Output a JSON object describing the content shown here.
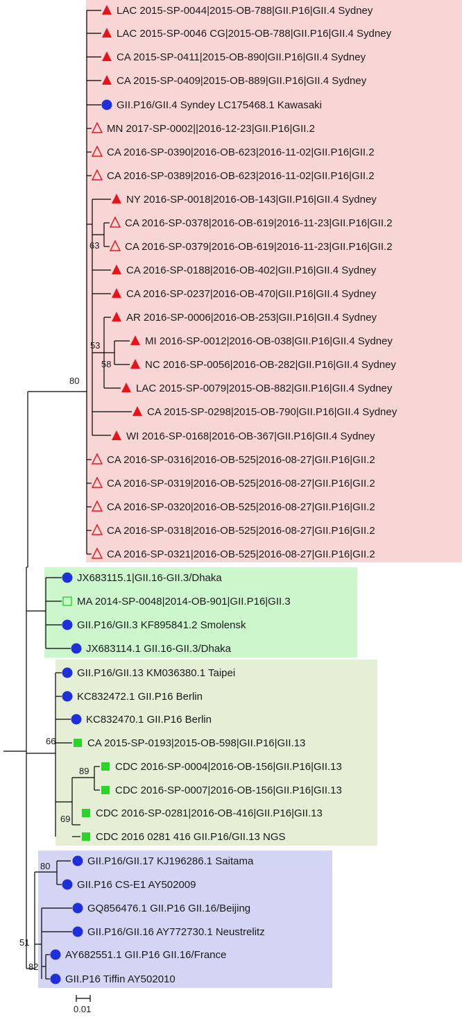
{
  "colors": {
    "red_marker": "#e8141b",
    "blue_marker": "#1f2fd9",
    "green_marker": "#2bd42b",
    "clade_red_bg": "#f9d6d6",
    "clade_green_bg": "#ccf7cc",
    "clade_olive_bg": "#e4efd6",
    "clade_blue_bg": "#d4d4f5"
  },
  "leaves": [
    {
      "label": "LAC 2015-SP-0044|2015-OB-788|GII.P16|GII.4 Sydney",
      "marker": "triangle-filled",
      "color": "red"
    },
    {
      "label": "LAC 2015-SP-0046 CG|2015-OB-788|GII.P16|GII.4 Sydney",
      "marker": "triangle-filled",
      "color": "red"
    },
    {
      "label": "CA 2015-SP-0411|2015-OB-890|GII.P16|GII.4 Sydney",
      "marker": "triangle-filled",
      "color": "red"
    },
    {
      "label": "CA 2015-SP-0409|2015-OB-889|GII.P16|GII.4 Sydney",
      "marker": "triangle-filled",
      "color": "red"
    },
    {
      "label": "GII.P16/GII.4 Syndey LC175468.1 Kawasaki",
      "marker": "circle-filled",
      "color": "blue"
    },
    {
      "label": "MN 2017-SP-0002||2016-12-23|GII.P16|GII.2",
      "marker": "triangle-open",
      "color": "red"
    },
    {
      "label": "CA 2016-SP-0390|2016-OB-623|2016-11-02|GII.P16|GII.2",
      "marker": "triangle-open",
      "color": "red"
    },
    {
      "label": "CA 2016-SP-0389|2016-OB-623|2016-11-02|GII.P16|GII.2",
      "marker": "triangle-open",
      "color": "red"
    },
    {
      "label": "NY 2016-SP-0018|2016-OB-143|GII.P16|GII.4 Sydney",
      "marker": "triangle-filled",
      "color": "red"
    },
    {
      "label": "CA 2016-SP-0378|2016-OB-619|2016-11-23|GII.P16|GII.2",
      "marker": "triangle-open",
      "color": "red"
    },
    {
      "label": "CA 2016-SP-0379|2016-OB-619|2016-11-23|GII.P16|GII.2",
      "marker": "triangle-open",
      "color": "red"
    },
    {
      "label": "CA 2016-SP-0188|2016-OB-402|GII.P16|GII.4 Sydney",
      "marker": "triangle-filled",
      "color": "red"
    },
    {
      "label": "CA 2016-SP-0237|2016-OB-470|GII.P16|GII.4 Sydney",
      "marker": "triangle-filled",
      "color": "red"
    },
    {
      "label": "AR 2016-SP-0006|2016-OB-253|GII.P16|GII.4 Sydney",
      "marker": "triangle-filled",
      "color": "red"
    },
    {
      "label": "MI 2016-SP-0012|2016-OB-038|GII.P16|GII.4 Sydney",
      "marker": "triangle-filled",
      "color": "red"
    },
    {
      "label": "NC 2016-SP-0056|2016-OB-282|GII.P16|GII.4 Sydney",
      "marker": "triangle-filled",
      "color": "red"
    },
    {
      "label": "LAC 2015-SP-0079|2015-OB-882|GII.P16|GII.4 Sydney",
      "marker": "triangle-filled",
      "color": "red"
    },
    {
      "label": "CA 2015-SP-0298|2015-OB-790|GII.P16|GII.4 Sydney",
      "marker": "triangle-filled",
      "color": "red"
    },
    {
      "label": "WI 2016-SP-0168|2016-OB-367|GII.P16|GII.4 Sydney",
      "marker": "triangle-filled",
      "color": "red"
    },
    {
      "label": "CA 2016-SP-0316|2016-OB-525|2016-08-27|GII.P16|GII.2",
      "marker": "triangle-open",
      "color": "red"
    },
    {
      "label": "CA 2016-SP-0319|2016-OB-525|2016-08-27|GII.P16|GII.2",
      "marker": "triangle-open",
      "color": "red"
    },
    {
      "label": "CA 2016-SP-0320|2016-OB-525|2016-08-27|GII.P16|GII.2",
      "marker": "triangle-open",
      "color": "red"
    },
    {
      "label": "CA 2016-SP-0318|2016-OB-525|2016-08-27|GII.P16|GII.2",
      "marker": "triangle-open",
      "color": "red"
    },
    {
      "label": "CA 2016-SP-0321|2016-OB-525|2016-08-27|GII.P16|GII.2",
      "marker": "triangle-open",
      "color": "red"
    },
    {
      "label": "JX683115.1|GII.16-GII.3/Dhaka",
      "marker": "circle-filled",
      "color": "blue"
    },
    {
      "label": "MA 2014-SP-0048|2014-OB-901|GII.P16|GII.3",
      "marker": "square-open",
      "color": "green"
    },
    {
      "label": "GII.P16/GII.3 KF895841.2 Smolensk",
      "marker": "circle-filled",
      "color": "blue"
    },
    {
      "label": "JX683114.1 GII.16-GII.3/Dhaka",
      "marker": "circle-filled",
      "color": "blue"
    },
    {
      "label": "GII.P16/GII.13 KM036380.1 Taipei",
      "marker": "circle-filled",
      "color": "blue"
    },
    {
      "label": "KC832472.1 GII.P16 Berlin",
      "marker": "circle-filled",
      "color": "blue"
    },
    {
      "label": "KC832470.1 GII.P16 Berlin",
      "marker": "circle-filled",
      "color": "blue"
    },
    {
      "label": "CA 2015-SP-0193|2015-OB-598|GII.P16|GII.13",
      "marker": "square-filled",
      "color": "green"
    },
    {
      "label": "CDC 2016-SP-0004|2016-OB-156|GII.P16|GII.13",
      "marker": "square-filled",
      "color": "green"
    },
    {
      "label": "CDC 2016-SP-0007|2016-OB-156|GII.P16|GII.13",
      "marker": "square-filled",
      "color": "green"
    },
    {
      "label": "CDC 2016-SP-0281|2016-OB-416|GII.P16|GII.13",
      "marker": "square-filled",
      "color": "green"
    },
    {
      "label": "CDC 2016 0281 416 GII.P16/GII.13 NGS",
      "marker": "square-filled",
      "color": "green"
    },
    {
      "label": "GII.P16/GII.17 KJ196286.1 Saitama",
      "marker": "circle-filled",
      "color": "blue"
    },
    {
      "label": "GII.P16 CS-E1 AY502009",
      "marker": "circle-filled",
      "color": "blue"
    },
    {
      "label": "GQ856476.1 GII.P16 GII.16/Beijing",
      "marker": "circle-filled",
      "color": "blue"
    },
    {
      "label": "GII.P16/GII.16 AY772730.1 Neustrelitz",
      "marker": "circle-filled",
      "color": "blue"
    },
    {
      "label": "AY682551.1 GII.P16 GII.16/France",
      "marker": "circle-filled",
      "color": "blue"
    },
    {
      "label": "GII.P16 Tiffin AY502010",
      "marker": "circle-filled",
      "color": "blue"
    }
  ],
  "bootstrap": [
    "80",
    "63",
    "53",
    "58",
    "66",
    "89",
    "69",
    "80",
    "51",
    "82"
  ],
  "scale_bar": {
    "label": "0.01"
  }
}
